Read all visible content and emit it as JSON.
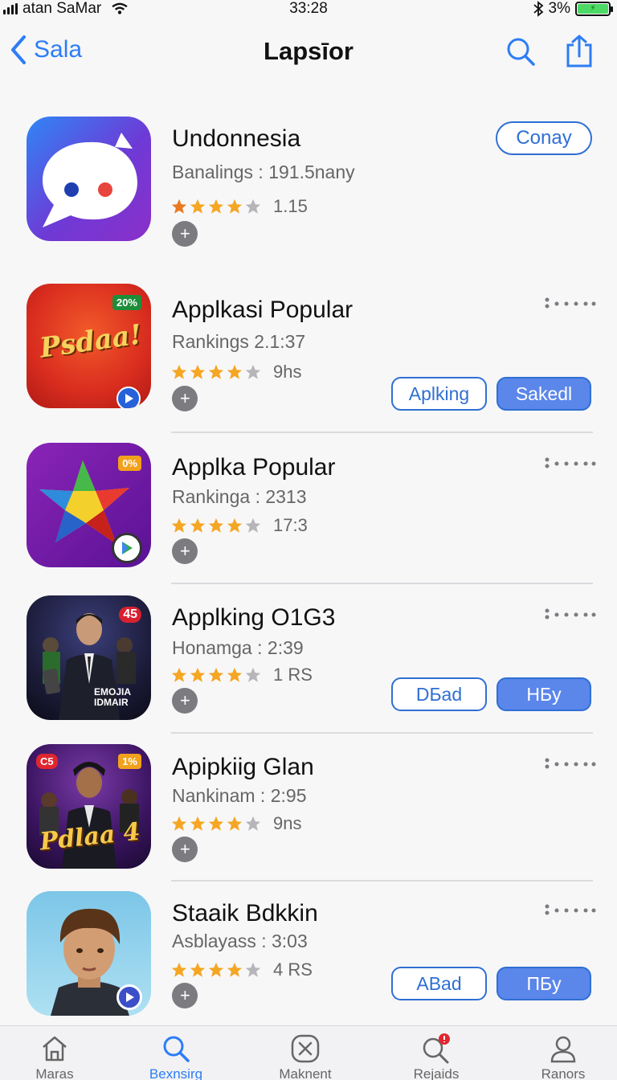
{
  "status_bar": {
    "carrier": "atan SaMar",
    "time": "33:28",
    "battery": "3%"
  },
  "nav": {
    "back_label": "Sala",
    "title": "Lapsīor"
  },
  "apps": [
    {
      "name": "Undonnesia",
      "ranking": "Banalings : 191.5nany",
      "rating": "1.15",
      "stars": 4,
      "action": "Conay"
    },
    {
      "name": "Applkasi Popular",
      "ranking": "Rankings 2.1:37",
      "rating": "9hs",
      "stars": 4,
      "badge": "20%",
      "icon_text": "Psdaa!",
      "buttons": [
        "Aplking",
        "Sakedl"
      ]
    },
    {
      "name": "Applka Popular",
      "ranking": "Rankinga : 2313",
      "rating": "17:3",
      "stars": 4,
      "badge": "0%"
    },
    {
      "name": "Applking O1G3",
      "ranking": "Honamga : 2:39",
      "rating": "1 RS",
      "stars": 4,
      "badge": "45",
      "icon_text": "EMOJIA\nIDMAIR",
      "buttons": [
        "DБad",
        "HБy"
      ]
    },
    {
      "name": "Apipkiig Glan",
      "ranking": "Nankinam : 2:95",
      "rating": "9ns",
      "stars": 4,
      "badge": "1%",
      "icon_text": "Pdlaa 4",
      "tag": "C5"
    },
    {
      "name": "Staaik Bdkkin",
      "ranking": "Asblayass : 3:03",
      "rating": "4 RS",
      "stars": 4,
      "buttons": [
        "ABad",
        "ПБy"
      ]
    }
  ],
  "tabs": [
    {
      "label": "Maras",
      "icon": "home-icon"
    },
    {
      "label": "Bexnsirg",
      "icon": "search-icon"
    },
    {
      "label": "Maknent",
      "icon": "x-box-icon"
    },
    {
      "label": "Rejaids",
      "icon": "search-alert-icon"
    },
    {
      "label": "Ranors",
      "icon": "person-icon"
    }
  ],
  "colors": {
    "accent": "#2d7df6",
    "button_fill": "#5b86ea",
    "star": "#f5a623",
    "battery": "#4cd964"
  }
}
